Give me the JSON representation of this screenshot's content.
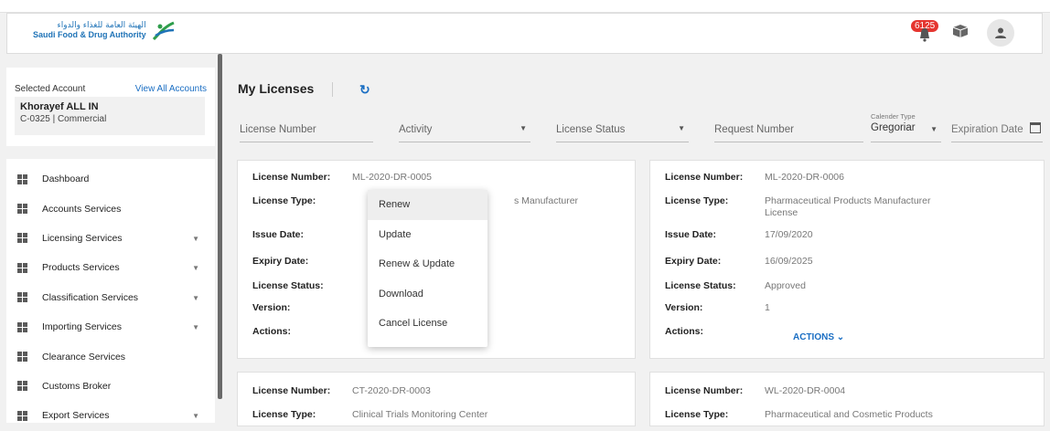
{
  "header": {
    "logo_arabic": "الهيئة العامة للغذاء والدواء",
    "logo_english": "Saudi Food & Drug Authority",
    "notification_count": "6125"
  },
  "sidebar": {
    "selected_account_label": "Selected Account",
    "view_all_label": "View All Accounts",
    "account_name": "Khorayef ALL IN",
    "account_code": "C-0325  |  Commercial",
    "items": [
      {
        "label": "Dashboard",
        "has_chevron": false
      },
      {
        "label": "Accounts Services",
        "has_chevron": false
      },
      {
        "label": "Licensing Services",
        "has_chevron": true
      },
      {
        "label": "Products Services",
        "has_chevron": true
      },
      {
        "label": "Classification Services",
        "has_chevron": true
      },
      {
        "label": "Importing Services",
        "has_chevron": true
      },
      {
        "label": "Clearance Services",
        "has_chevron": false
      },
      {
        "label": "Customs Broker",
        "has_chevron": false
      },
      {
        "label": "Export Services",
        "has_chevron": true
      }
    ]
  },
  "main": {
    "title": "My Licenses",
    "filters": {
      "license_number": "License Number",
      "activity": "Activity",
      "license_status": "License Status",
      "request_number": "Request Number",
      "calendar_type_label": "Calender Type",
      "calendar_type_value": "Gregoriar",
      "expiration_date": "Expiration Date"
    },
    "labels": {
      "license_number": "License Number:",
      "license_type": "License Type:",
      "issue_date": "Issue Date:",
      "expiry_date": "Expiry Date:",
      "license_status": "License Status:",
      "version": "Version:",
      "actions": "Actions:"
    },
    "cards": [
      {
        "license_number": "ML-2020-DR-0005",
        "license_type_partial": "s Manufacturer"
      },
      {
        "license_number": "ML-2020-DR-0006",
        "license_type_line1": "Pharmaceutical Products Manufacturer",
        "license_type_line2": "License",
        "issue_date": "17/09/2020",
        "expiry_date": "16/09/2025",
        "license_status": "Approved",
        "version": "1",
        "actions_button": "ACTIONS ⌄"
      },
      {
        "license_number": "CT-2020-DR-0003",
        "license_type": "Clinical Trials Monitoring Center"
      },
      {
        "license_number": "WL-2020-DR-0004",
        "license_type": "Pharmaceutical and Cosmetic Products"
      }
    ],
    "dropdown": [
      "Renew",
      "Update",
      "Renew & Update",
      "Download",
      "Cancel License"
    ]
  }
}
